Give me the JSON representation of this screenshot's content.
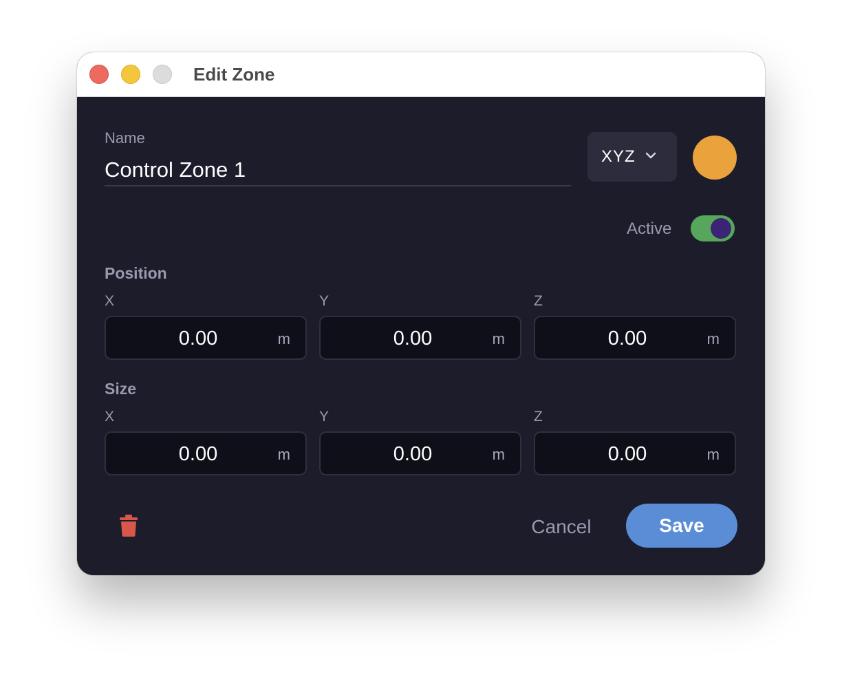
{
  "window": {
    "title": "Edit Zone"
  },
  "name": {
    "label": "Name",
    "value": "Control Zone 1"
  },
  "coordinate_system": {
    "selected": "XYZ"
  },
  "color": {
    "value": "#e9a23c"
  },
  "active": {
    "label": "Active",
    "on": true,
    "track_color": "#57a65c",
    "knob_color": "#3b2475"
  },
  "position": {
    "heading": "Position",
    "fields": [
      {
        "axis": "X",
        "value": "0.00",
        "unit": "m"
      },
      {
        "axis": "Y",
        "value": "0.00",
        "unit": "m"
      },
      {
        "axis": "Z",
        "value": "0.00",
        "unit": "m"
      }
    ]
  },
  "size": {
    "heading": "Size",
    "fields": [
      {
        "axis": "X",
        "value": "0.00",
        "unit": "m"
      },
      {
        "axis": "Y",
        "value": "0.00",
        "unit": "m"
      },
      {
        "axis": "Z",
        "value": "0.00",
        "unit": "m"
      }
    ]
  },
  "actions": {
    "delete_icon": "trash-icon",
    "delete_color": "#d9574a",
    "cancel_label": "Cancel",
    "save_label": "Save",
    "save_color": "#5a8dd6"
  }
}
